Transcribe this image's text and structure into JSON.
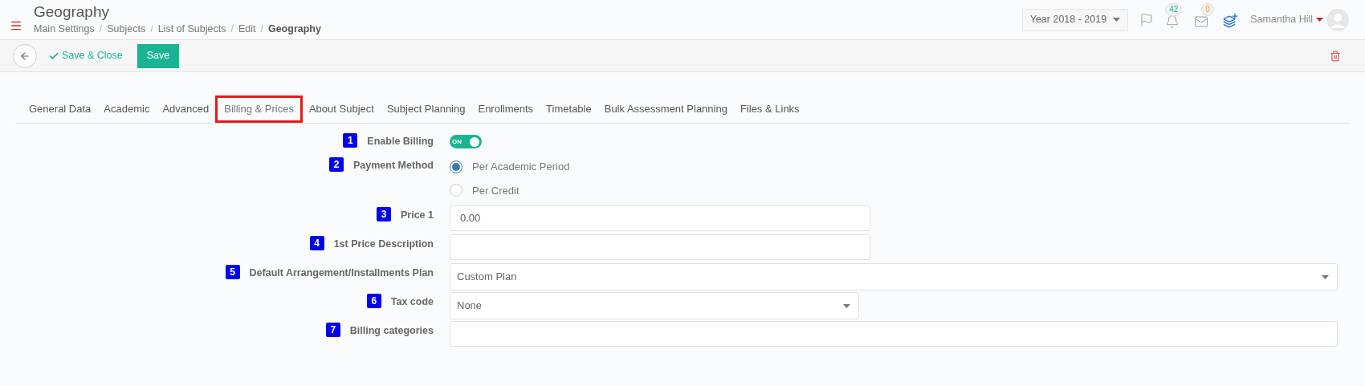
{
  "header": {
    "title": "Geography",
    "breadcrumbs": [
      {
        "label": "Main Settings",
        "current": false
      },
      {
        "label": "Subjects",
        "current": false
      },
      {
        "label": "List of Subjects",
        "current": false
      },
      {
        "label": "Edit",
        "current": false
      },
      {
        "label": "Geography",
        "current": true
      }
    ],
    "separator": "/",
    "year": "Year 2018 - 2019",
    "notifications": "42",
    "messages": "0",
    "user": "Samantha Hill"
  },
  "toolbar": {
    "save_close": "Save & Close",
    "save": "Save"
  },
  "tabs": [
    {
      "label": "General Data",
      "selected": false
    },
    {
      "label": "Academic",
      "selected": false
    },
    {
      "label": "Advanced",
      "selected": false
    },
    {
      "label": "Billing & Prices",
      "selected": true
    },
    {
      "label": "About Subject",
      "selected": false
    },
    {
      "label": "Subject Planning",
      "selected": false
    },
    {
      "label": "Enrollments",
      "selected": false
    },
    {
      "label": "Timetable",
      "selected": false
    },
    {
      "label": "Bulk Assessment Planning",
      "selected": false
    },
    {
      "label": "Files & Links",
      "selected": false
    }
  ],
  "fields": [
    {
      "kind": "toggle",
      "marker": "1",
      "label": "Enable Billing",
      "on": true,
      "state_text": "ON"
    },
    {
      "kind": "radio",
      "marker": "2",
      "label": "Payment Method",
      "options": [
        {
          "label": "Per Academic Period",
          "selected": true
        },
        {
          "label": "Per Credit",
          "selected": false
        }
      ]
    },
    {
      "kind": "text",
      "marker": "3",
      "label": "Price 1",
      "value": "0.00",
      "wide": false
    },
    {
      "kind": "text",
      "marker": "4",
      "label": "1st Price Description",
      "wide": false
    },
    {
      "kind": "select",
      "marker": "5",
      "label": "Default Arrangement/Installments Plan",
      "value": "Custom Plan",
      "wide": true
    },
    {
      "kind": "select",
      "marker": "6",
      "label": "Tax code",
      "value": "None",
      "wide": false
    },
    {
      "kind": "text",
      "marker": "7",
      "label": "Billing categories",
      "wide": true
    }
  ]
}
